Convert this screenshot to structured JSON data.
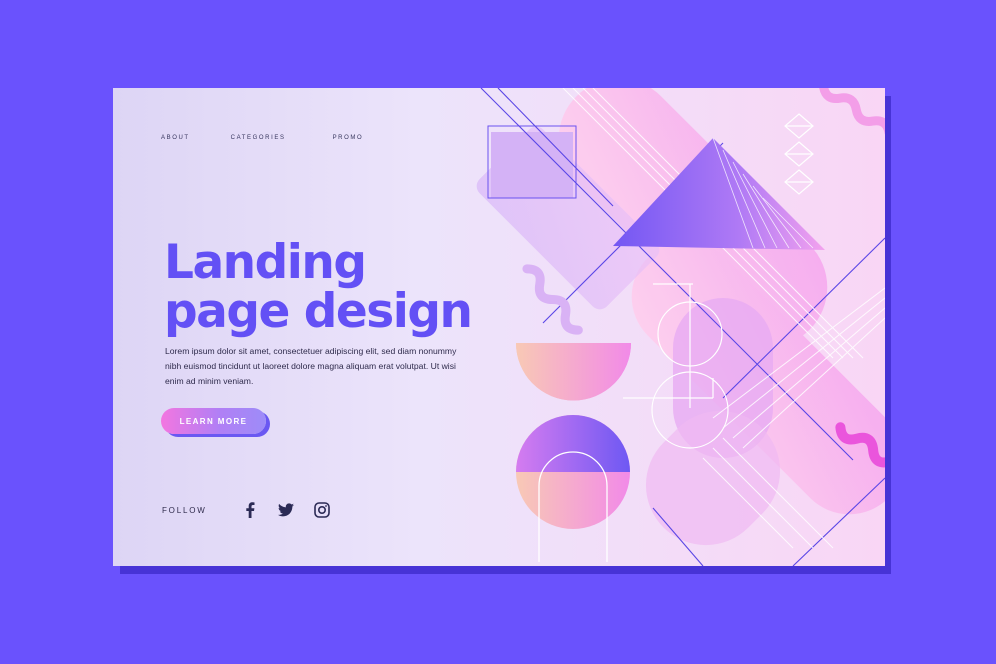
{
  "nav": {
    "items": [
      "ABOUT",
      "CATEGORIES",
      "PROMO"
    ]
  },
  "hero": {
    "title_line1": "Landing",
    "title_line2": "page design",
    "body": "Lorem ipsum dolor sit amet, consectetuer adipiscing elit, sed diam nonummy nibh euismod tincidunt ut laoreet dolore magna aliquam erat volutpat. Ut wisi enim ad minim veniam.",
    "cta_label": "LEARN MORE"
  },
  "follow": {
    "label": "FOLLOW",
    "icons": [
      "facebook-icon",
      "twitter-icon",
      "instagram-icon"
    ]
  },
  "colors": {
    "background": "#6a52fd",
    "accent": "#6350f5",
    "text": "#2f2b4c",
    "pink": "#f07ae2"
  }
}
